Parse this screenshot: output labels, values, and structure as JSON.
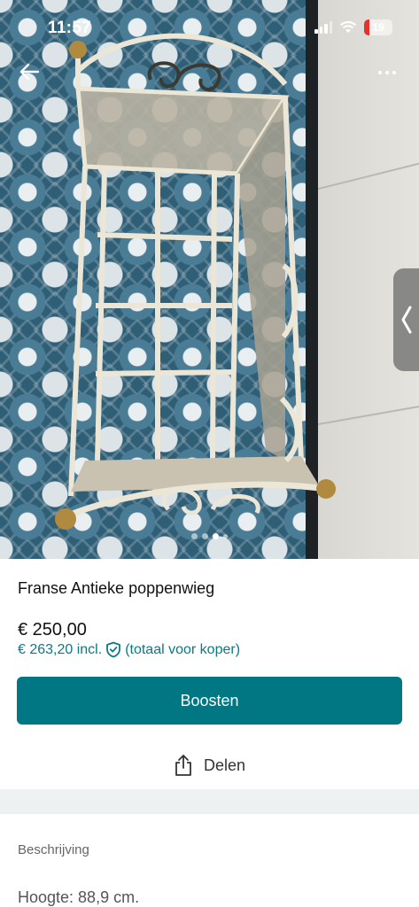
{
  "status_bar": {
    "time": "11:57",
    "battery": "19"
  },
  "photo": {
    "active_index": 2,
    "count": 4
  },
  "listing": {
    "title": "Franse Antieke poppenwieg",
    "price": "€ 250,00",
    "price_incl": "€ 263,20 incl.",
    "price_incl_note": "(totaal voor koper)"
  },
  "actions": {
    "boost_label": "Boosten",
    "share_label": "Delen"
  },
  "description": {
    "section_label": "Beschrijving",
    "first_line": "Hoogte: 88,9 cm."
  },
  "colors": {
    "accent": "#007782",
    "link": "#0a7a85",
    "divider": "#eef1f1"
  },
  "icons": [
    "back-arrow-icon",
    "more-icon",
    "chevron-left-icon",
    "shield-check-icon",
    "share-icon",
    "wifi-icon",
    "signal-icon",
    "battery-icon"
  ]
}
